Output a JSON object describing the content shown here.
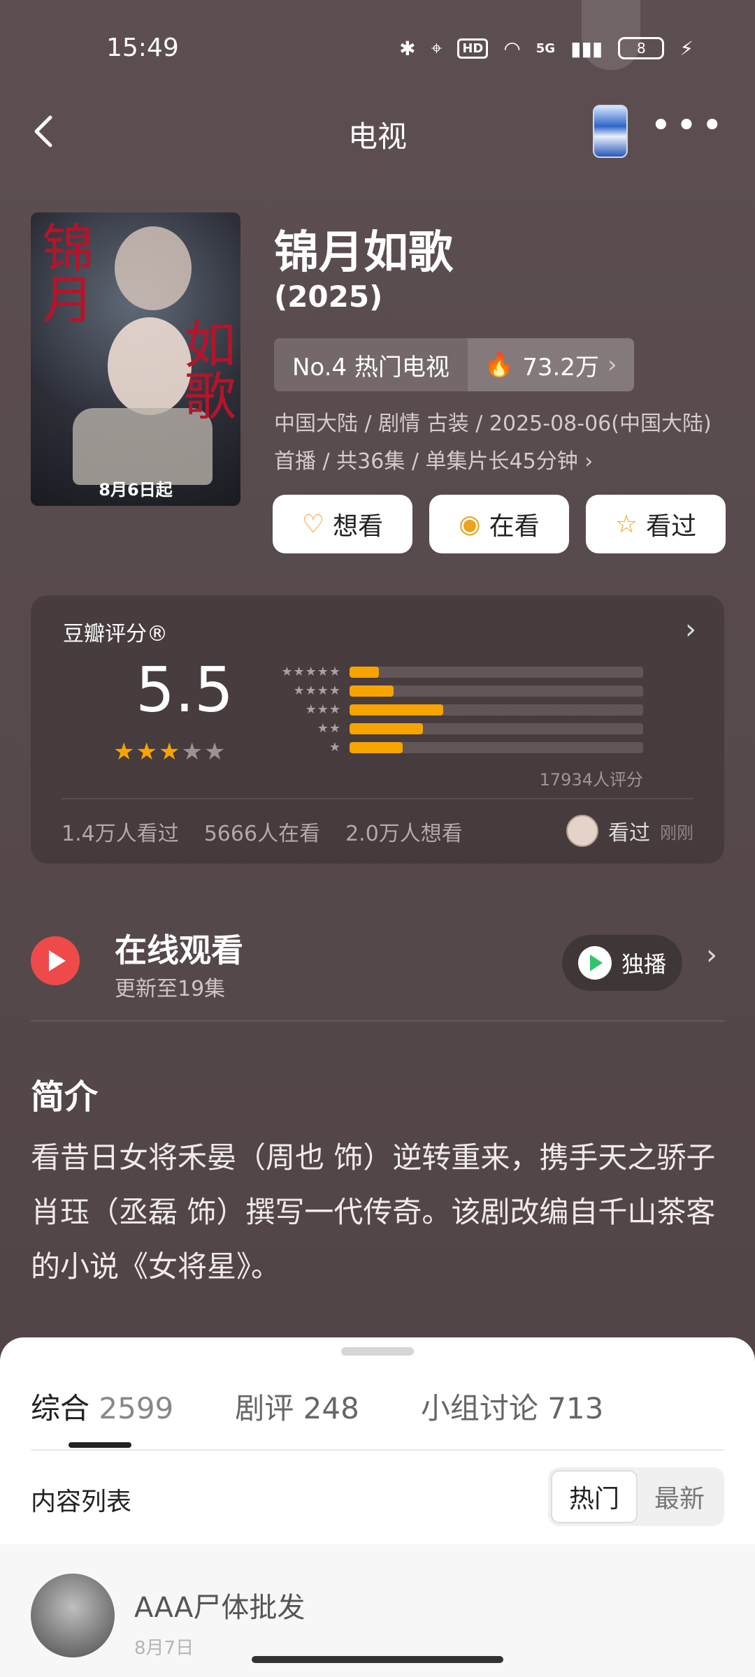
{
  "status": {
    "time": "15:49",
    "network": "5G",
    "battery": "8"
  },
  "nav": {
    "title": "电视"
  },
  "poster": {
    "title_red_1": "锦月",
    "title_red_2": "如歌",
    "date": "8月6日起"
  },
  "show": {
    "title": "锦月如歌",
    "year": "(2025)",
    "rank": "No.4 热门电视",
    "heat": "73.2万",
    "meta": "中国大陆 / 剧情 古装 / 2025-08-06(中国大陆)首播 / 共36集 / 单集片长45分钟",
    "actions": [
      {
        "label": "想看",
        "icon": "heart-plus-icon"
      },
      {
        "label": "在看",
        "icon": "target-icon"
      },
      {
        "label": "看过",
        "icon": "star-icon"
      }
    ]
  },
  "rating": {
    "label": "豆瓣评分®",
    "score": "5.5",
    "stars": 2.75,
    "distribution": [
      {
        "stars": 5,
        "fraction": 0.1
      },
      {
        "stars": 4,
        "fraction": 0.15
      },
      {
        "stars": 3,
        "fraction": 0.32
      },
      {
        "stars": 2,
        "fraction": 0.25
      },
      {
        "stars": 1,
        "fraction": 0.18
      }
    ],
    "count": "17934人评分",
    "watched": "1.4万人看过",
    "watching": "5666人在看",
    "want": "2.0万人想看",
    "friend_status": "看过",
    "friend_time": "刚刚"
  },
  "online": {
    "title": "在线观看",
    "subtitle": "更新至19集",
    "platform": "独播"
  },
  "synopsis": {
    "title": "简介",
    "text": "看昔日女将禾晏（周也 饰）逆转重来，携手天之骄子肖珏（丞磊 饰）撰写一代传奇。该剧改编自千山茶客的小说《女将星》。"
  },
  "sheet": {
    "tabs": [
      {
        "label": "综合",
        "count": "2599"
      },
      {
        "label": "剧评",
        "count": "248"
      },
      {
        "label": "小组讨论",
        "count": "713"
      }
    ],
    "list_label": "内容列表",
    "sort_hot": "热门",
    "sort_new": "最新",
    "post": {
      "author": "AAA尸体批发",
      "date": "8月7日"
    }
  },
  "colors": {
    "background": "#574a4c",
    "star": "#f7a400",
    "play": "#ef4a4a"
  }
}
